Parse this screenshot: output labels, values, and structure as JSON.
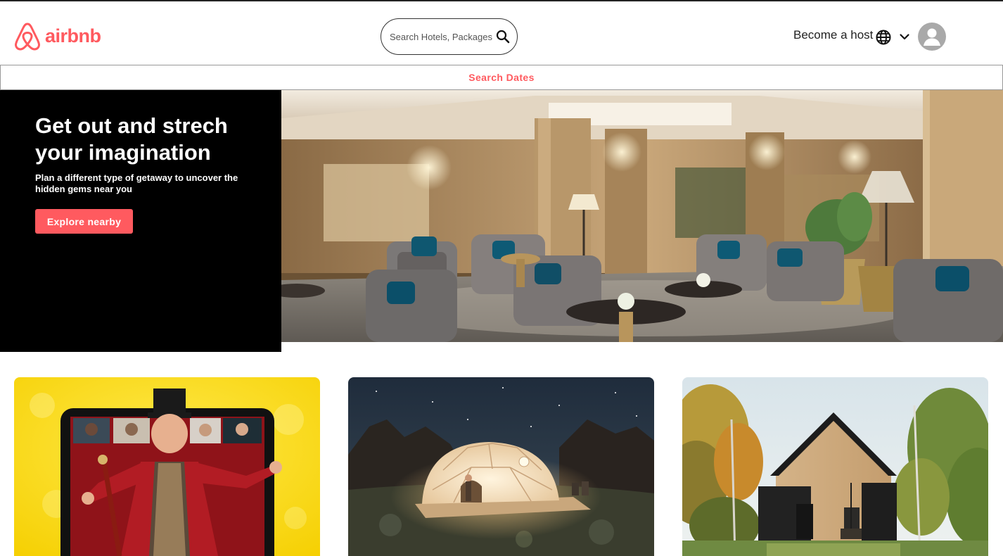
{
  "header": {
    "brand": "airbnb",
    "search_placeholder": "Search Hotels, Packages",
    "become_host": "Become a host"
  },
  "dates_bar": {
    "label": "Search Dates"
  },
  "hero": {
    "title": "Get out and strech your imagination",
    "subtitle": "Plan a different type of getaway to uncover the hidden gems near you",
    "button": "Explore nearby"
  },
  "colors": {
    "brand": "#ff5a5f",
    "hero_bg": "#000000"
  },
  "icons": [
    "airbnb-logo-icon",
    "search-icon",
    "globe-icon",
    "chevron-down-icon",
    "user-avatar-icon"
  ]
}
